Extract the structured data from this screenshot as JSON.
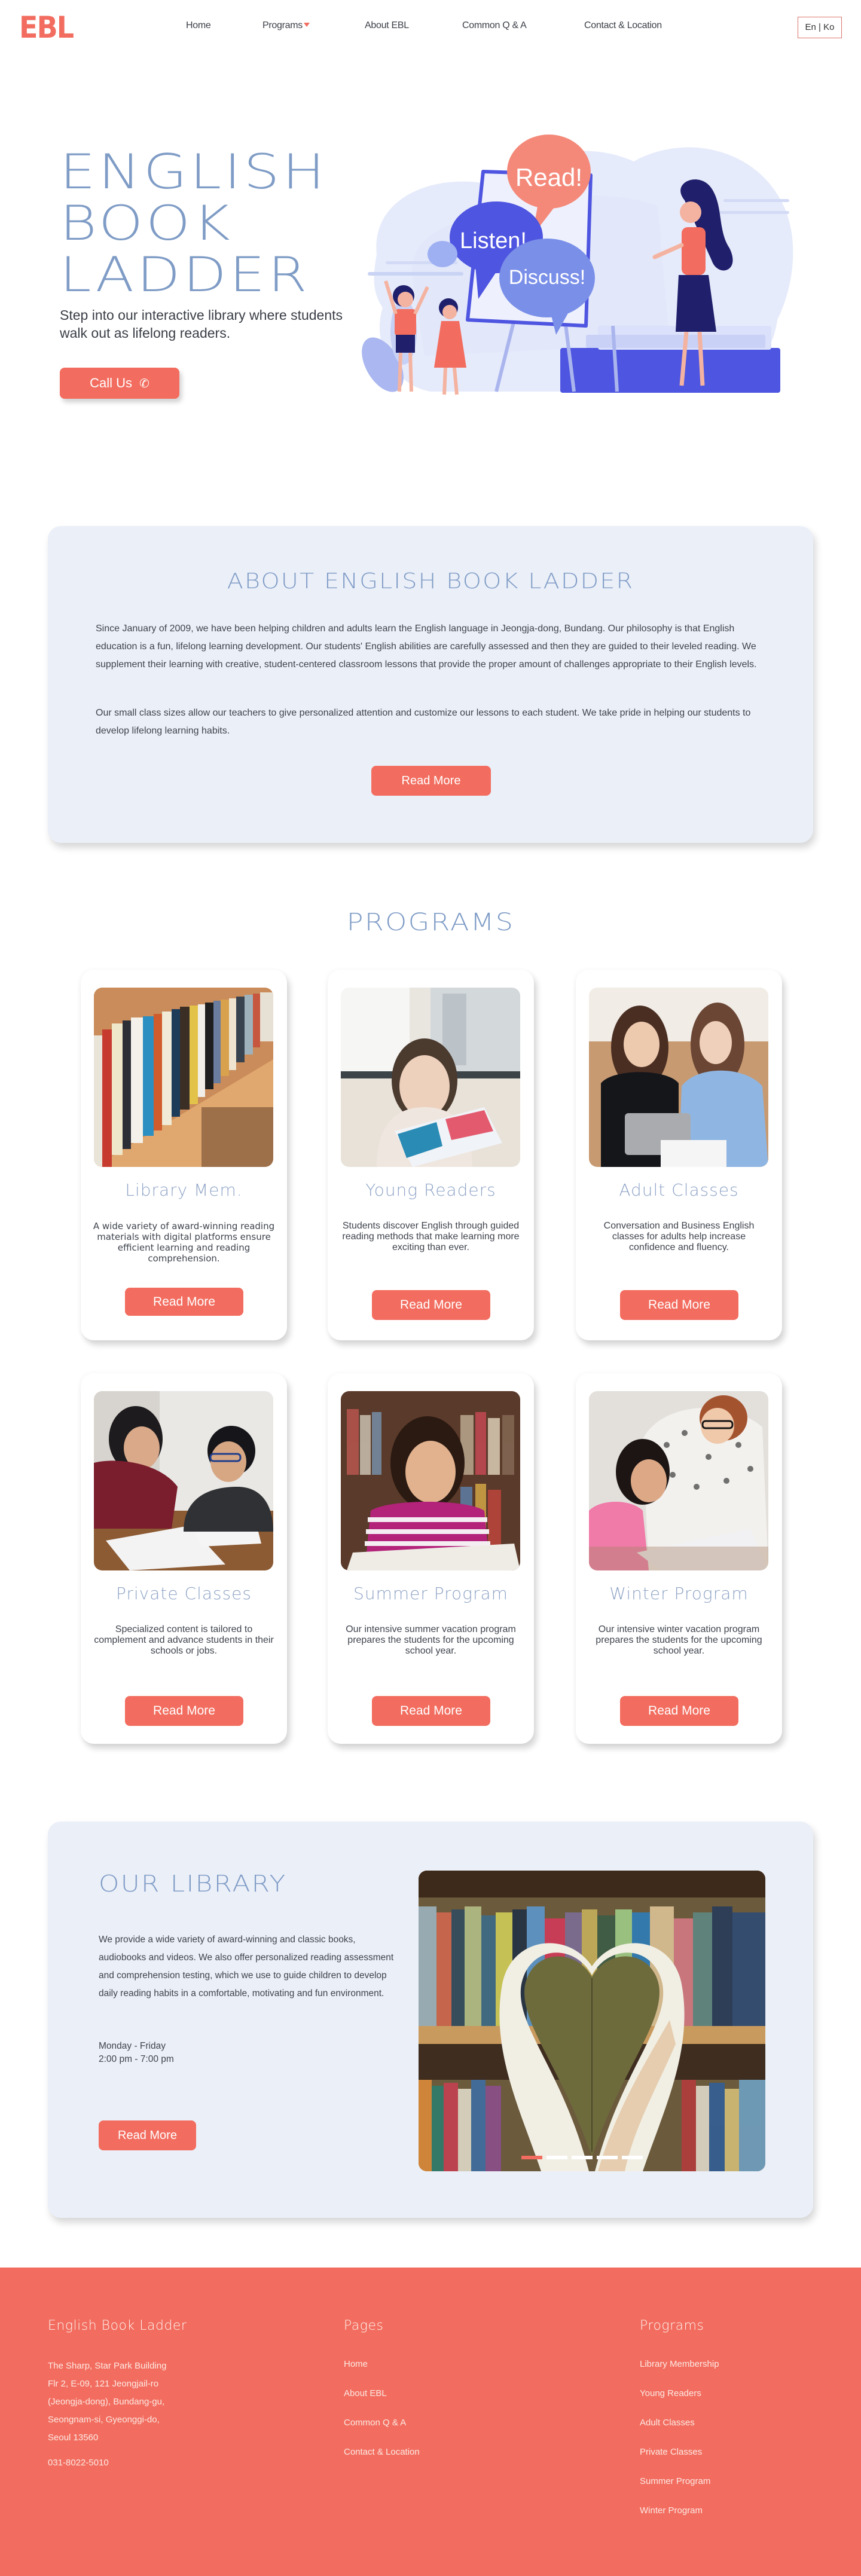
{
  "header": {
    "logo": "EBL",
    "nav": [
      {
        "label": "Home"
      },
      {
        "label": "Programs",
        "has_dropdown": true
      },
      {
        "label": "About EBL"
      },
      {
        "label": "Common Q & A"
      },
      {
        "label": "Contact & Location"
      }
    ],
    "language_toggle": "En | Ko"
  },
  "hero": {
    "title_lines": [
      "ENGLISH",
      "BOOK",
      "LADDER"
    ],
    "subtitle": "Step into our interactive library where students walk out as lifelong readers.",
    "call_button": "Call Us",
    "call_icon": "phone-icon",
    "illustration": {
      "bubbles": [
        "Read!",
        "Listen!",
        "Discuss!"
      ]
    }
  },
  "about": {
    "title": "ABOUT ENGLISH BOOK LADDER",
    "paragraphs": [
      "Since January of 2009, we have been helping children and adults learn the English language in Jeongja-dong, Bundang. Our philosophy is that English education is a fun, lifelong learning development. Our students' English abilities are carefully assessed and then they are guided to their leveled reading. We supplement their learning with creative, student-centered classroom lessons that provide the proper amount of challenges appropriate to their English levels.",
      "Our small class sizes allow our teachers to give personalized attention and customize our lessons to each student. We take pride in helping our students to develop lifelong learning habits."
    ],
    "button": "Read More"
  },
  "programs": {
    "title": "PROGRAMS",
    "cards": [
      {
        "title": "Library Mem.",
        "description": "A wide variety of award-winning reading materials with digital platforms ensure efficient learning and reading comprehension.",
        "button": "Read More",
        "image": "bookshelf-photo"
      },
      {
        "title": "Young Readers",
        "description": "Students discover English through guided reading methods that make learning more exciting than ever.",
        "button": "Read More",
        "image": "girl-reading-photo"
      },
      {
        "title": "Adult Classes",
        "description": "Conversation and Business English classes for adults help increase confidence and fluency.",
        "button": "Read More",
        "image": "adults-talking-photo"
      },
      {
        "title": "Private Classes",
        "description": "Specialized content is tailored to complement and advance students in their schools or jobs.",
        "button": "Read More",
        "image": "tutor-student-photo"
      },
      {
        "title": "Summer Program",
        "description": "Our intensive summer vacation program prepares the students for the upcoming school year.",
        "button": "Read More",
        "image": "girl-studying-library-photo"
      },
      {
        "title": "Winter Program",
        "description": "Our intensive winter vacation program prepares the students for the upcoming school year.",
        "button": "Read More",
        "image": "teacher-helping-girl-photo"
      }
    ]
  },
  "library": {
    "title": "OUR LIBRARY",
    "text": "We provide a wide variety of award-winning and classic books, audiobooks and videos. We also offer personalized reading assessment and comprehension testing, which we use to guide children to develop daily reading habits in a comfortable, motivating and fun environment.",
    "hours_days": "Monday - Friday",
    "hours_time": "2:00 pm - 7:00 pm",
    "button": "Read More",
    "carousel": {
      "slide_count": 5,
      "active_slide": 1,
      "image": "heart-book-photo"
    }
  },
  "footer": {
    "brand": {
      "title": "English Book Ladder",
      "address_lines": [
        "The Sharp, Star Park Building",
        "Flr 2, E-09, 121 Jeongjail-ro",
        "(Jeongja-dong), Bundang-gu,",
        "Seongnam-si, Gyeonggi-do,",
        "Seoul 13560"
      ],
      "phone": "031-8022-5010"
    },
    "pages": {
      "title": "Pages",
      "links": [
        "Home",
        "About EBL",
        "Common Q & A",
        "Contact & Location"
      ]
    },
    "programs": {
      "title": "Programs",
      "links": [
        "Library Membership",
        "Young Readers",
        "Adult Classes",
        "Private Classes",
        "Summer Program",
        "Winter Program"
      ]
    }
  },
  "colors": {
    "accent": "#f26d5f",
    "heading": "#7f9cc6",
    "panel": "#ebeff8"
  }
}
